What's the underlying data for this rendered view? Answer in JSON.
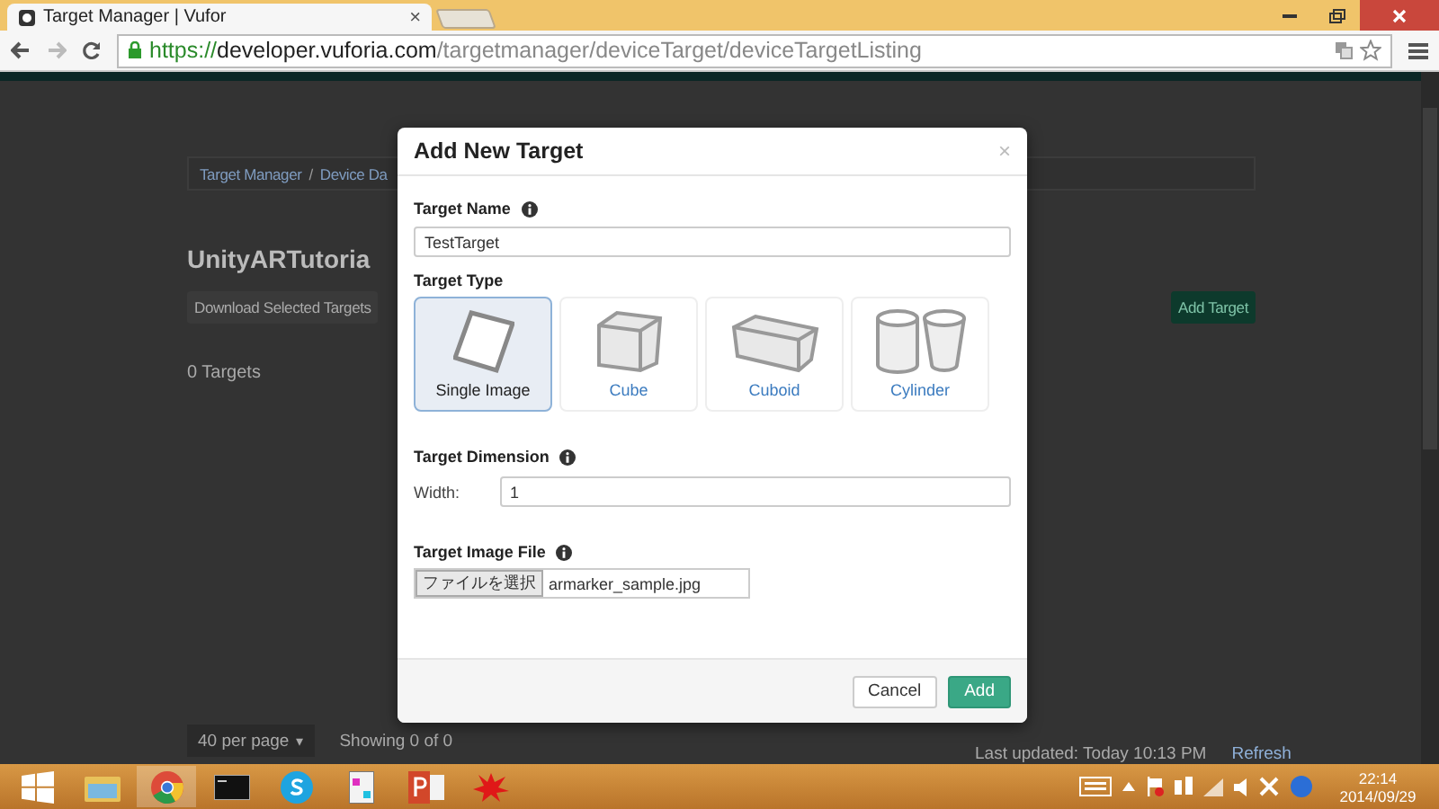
{
  "browser": {
    "tab": {
      "title": "Target Manager | Vufor",
      "close": "×"
    },
    "url": {
      "scheme": "https://",
      "host": "developer.vuforia.com",
      "path": "/targetmanager/deviceTarget/deviceTargetListing"
    }
  },
  "page": {
    "breadcrumb": [
      "Target Manager",
      "Device Da"
    ],
    "breadcrumb_separator": "/",
    "per_page_caret": "▾",
    "heading": "UnityARTutoria",
    "download_button": "Download Selected Targets",
    "add_button": "Add Target",
    "count": "0 Targets",
    "per_page": "40 per page",
    "showing": "Showing 0 of 0",
    "last_updated": "Last updated: Today 10:13 PM",
    "refresh": "Refresh"
  },
  "modal": {
    "title": "Add New Target",
    "close": "×",
    "target_name": {
      "label": "Target Name",
      "value": "TestTarget"
    },
    "target_type": {
      "label": "Target Type",
      "options": [
        {
          "kind": "image",
          "label": "Single Image",
          "selected": true
        },
        {
          "kind": "cube",
          "label": "Cube",
          "selected": false
        },
        {
          "kind": "cuboid",
          "label": "Cuboid",
          "selected": false
        },
        {
          "kind": "cylinder",
          "label": "Cylinder",
          "selected": false
        }
      ]
    },
    "target_dimension": {
      "label": "Target Dimension",
      "width_label": "Width:",
      "width_value": "1"
    },
    "image_file": {
      "label": "Target Image File",
      "button": "ファイルを選択",
      "file": "armarker_sample.jpg"
    },
    "buttons": [
      {
        "kind": "cancel",
        "label": "Cancel"
      },
      {
        "kind": "add",
        "label": "Add"
      }
    ]
  },
  "taskbar": {
    "time": "22:14",
    "date": "2014/09/29"
  }
}
